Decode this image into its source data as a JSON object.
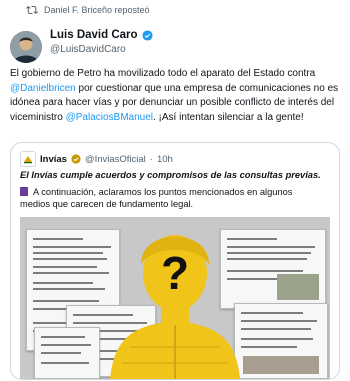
{
  "repost": {
    "label": "Daniel F. Briceño reposteó",
    "icon": "repost-icon"
  },
  "tweet": {
    "author_name": "Luis David Caro",
    "author_handle": "@LuisDavidCaro",
    "verified_icon": "verified-badge-icon",
    "body": {
      "p1": "El gobierno de Petro ha movilizado todo el aparato del Estado contra ",
      "mention1": "@Danielbricen",
      "p2": " por cuestionar que una empresa de comunicaciones no es idónea para hacer vías y por denunciar un posible conflicto de interés del viceministro ",
      "mention2": "@PalaciosBManuel",
      "p3": ". ¡Así intentan silenciar a la gente!"
    }
  },
  "quoted": {
    "name": "Invías",
    "handle": "@InviasOficial",
    "separator": "·",
    "time": "10h",
    "headline": "El Invías cumple acuerdos y compromisos de las consultas previas.",
    "text": "A continuación, aclaramos los puntos mencionados en algunos medios que carecen de fundamento legal.",
    "media_overlay": "?"
  },
  "colors": {
    "accent": "#1d9bf0",
    "verified": "#1d9bf0",
    "overlay_yellow": "#f0c419",
    "bullet_purple": "#6a3e98"
  }
}
